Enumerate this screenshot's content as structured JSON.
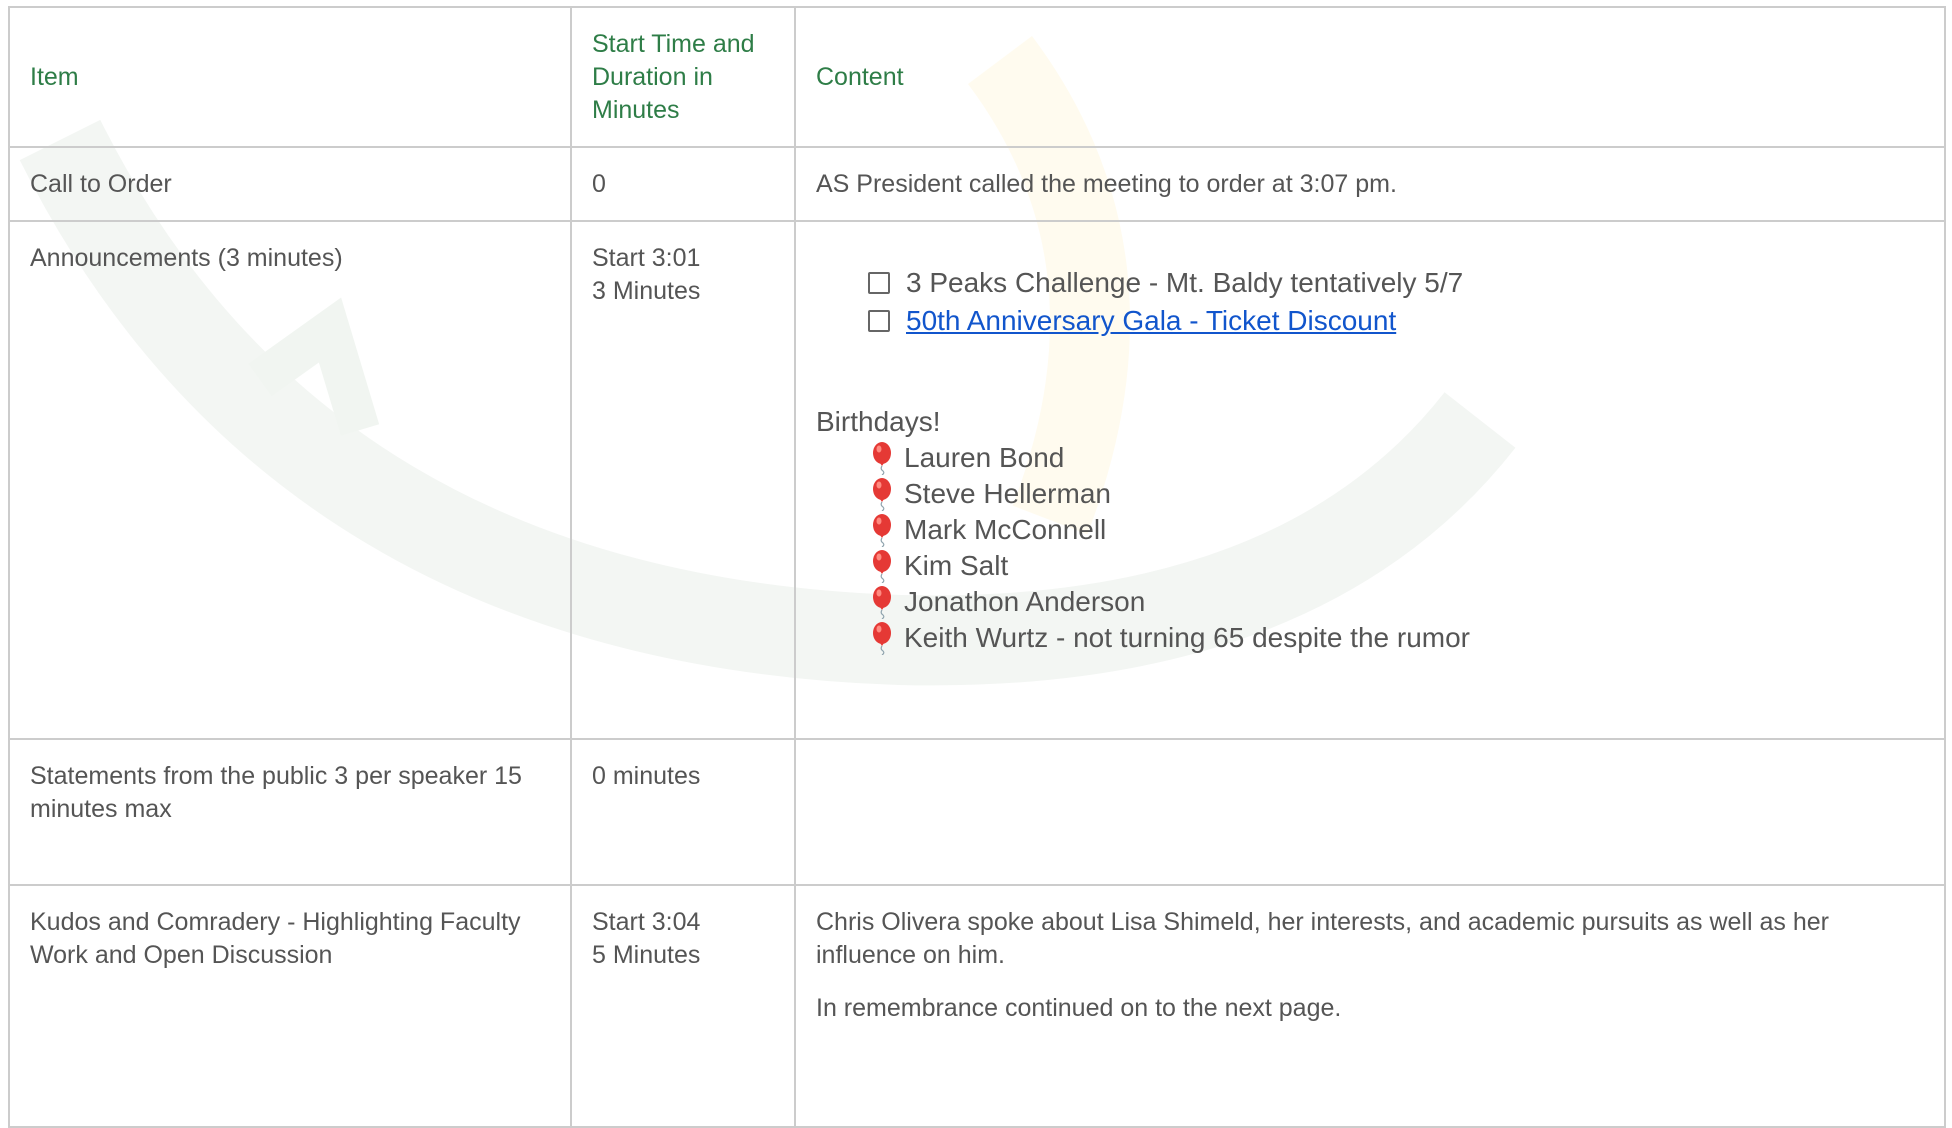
{
  "header": {
    "item": "Item",
    "start_time": "Start Time and Duration in Minutes",
    "content": "Content"
  },
  "rows": [
    {
      "item": "Call to Order",
      "time": "0",
      "content": "AS President called the meeting to order at 3:07 pm."
    },
    {
      "item": "Announcements (3 minutes)",
      "time_line1": "Start 3:01",
      "time_line2": "3 Minutes",
      "checklist": [
        {
          "label": "3 Peaks Challenge - Mt. Baldy tentatively 5/7",
          "link": false,
          "checked": false
        },
        {
          "label": "50th Anniversary Gala - Ticket Discount",
          "link": true,
          "checked": false
        }
      ],
      "birthdays_title": "Birthdays!",
      "birthdays": [
        "Lauren Bond",
        "Steve Hellerman",
        "Mark McConnell",
        "Kim Salt",
        "Jonathon Anderson",
        "Keith Wurtz - not turning 65 despite the rumor"
      ],
      "birthday_icon": "balloon-icon"
    },
    {
      "item": "Statements from the public 3 per speaker 15 minutes max",
      "time": "0 minutes",
      "content": ""
    },
    {
      "item": "Kudos and Comradery - Highlighting Faculty Work and Open Discussion",
      "time_line1": "Start 3:04",
      "time_line2": "5 Minutes",
      "content_p1": "Chris Olivera spoke about Lisa Shimeld, her interests, and academic pursuits as well as her influence on him.",
      "content_p2": "In remembrance continued on to the next page."
    }
  ],
  "colors": {
    "header_text": "#2e7d47",
    "body_text": "#555555",
    "link": "#1155cc",
    "border": "#cccccc",
    "balloon": "#e53935"
  }
}
